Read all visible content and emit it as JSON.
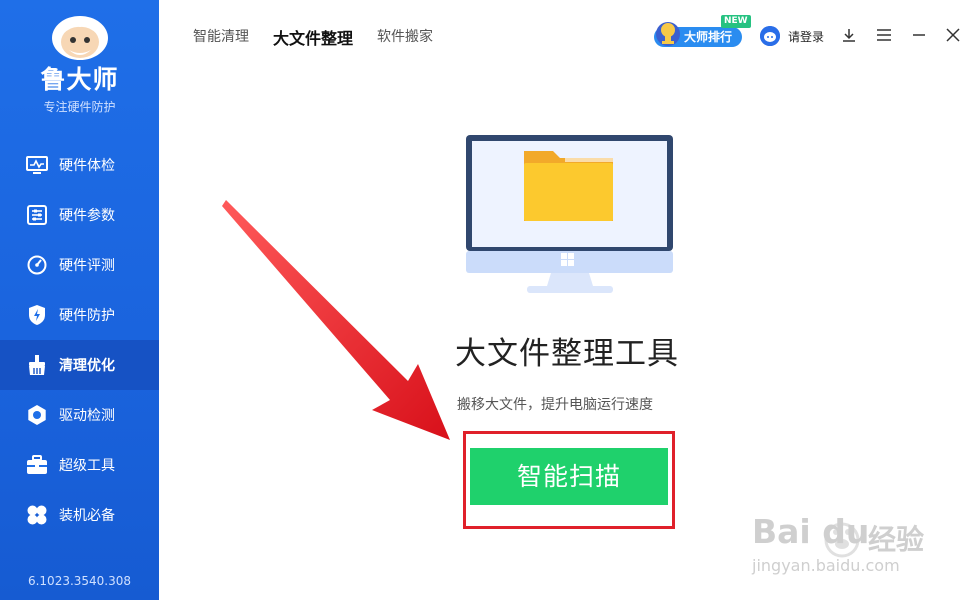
{
  "sidebar": {
    "brand": "鲁大师",
    "slogan": "专注硬件防护",
    "items": [
      {
        "label": "硬件体检",
        "icon": "monitor-pulse-icon"
      },
      {
        "label": "硬件参数",
        "icon": "sliders-icon"
      },
      {
        "label": "硬件评测",
        "icon": "gauge-icon"
      },
      {
        "label": "硬件防护",
        "icon": "shield-bolt-icon"
      },
      {
        "label": "清理优化",
        "icon": "broom-icon"
      },
      {
        "label": "驱动检测",
        "icon": "gear-icon"
      },
      {
        "label": "超级工具",
        "icon": "toolbox-icon"
      },
      {
        "label": "装机必备",
        "icon": "clover-icon"
      }
    ],
    "active_index": 4,
    "version": "6.1023.3540.308"
  },
  "header": {
    "tabs": [
      "智能清理",
      "大文件整理",
      "软件搬家"
    ],
    "active_tab": 1,
    "rank_label": "大师排行",
    "new_badge": "NEW",
    "login_label": "请登录"
  },
  "main": {
    "title": "大文件整理工具",
    "subtitle": "搬移大文件，提升电脑运行速度",
    "scan_button": "智能扫描"
  },
  "watermark": {
    "brand": "Bai du",
    "chinese": "经验",
    "url": "jingyan.baidu.com"
  },
  "colors": {
    "sidebar": "#1f6fe8",
    "sidebar_active": "#1652c4",
    "scan_button": "#1fd16c",
    "highlight_frame": "#e0202a",
    "arrow": "#e0202a"
  }
}
